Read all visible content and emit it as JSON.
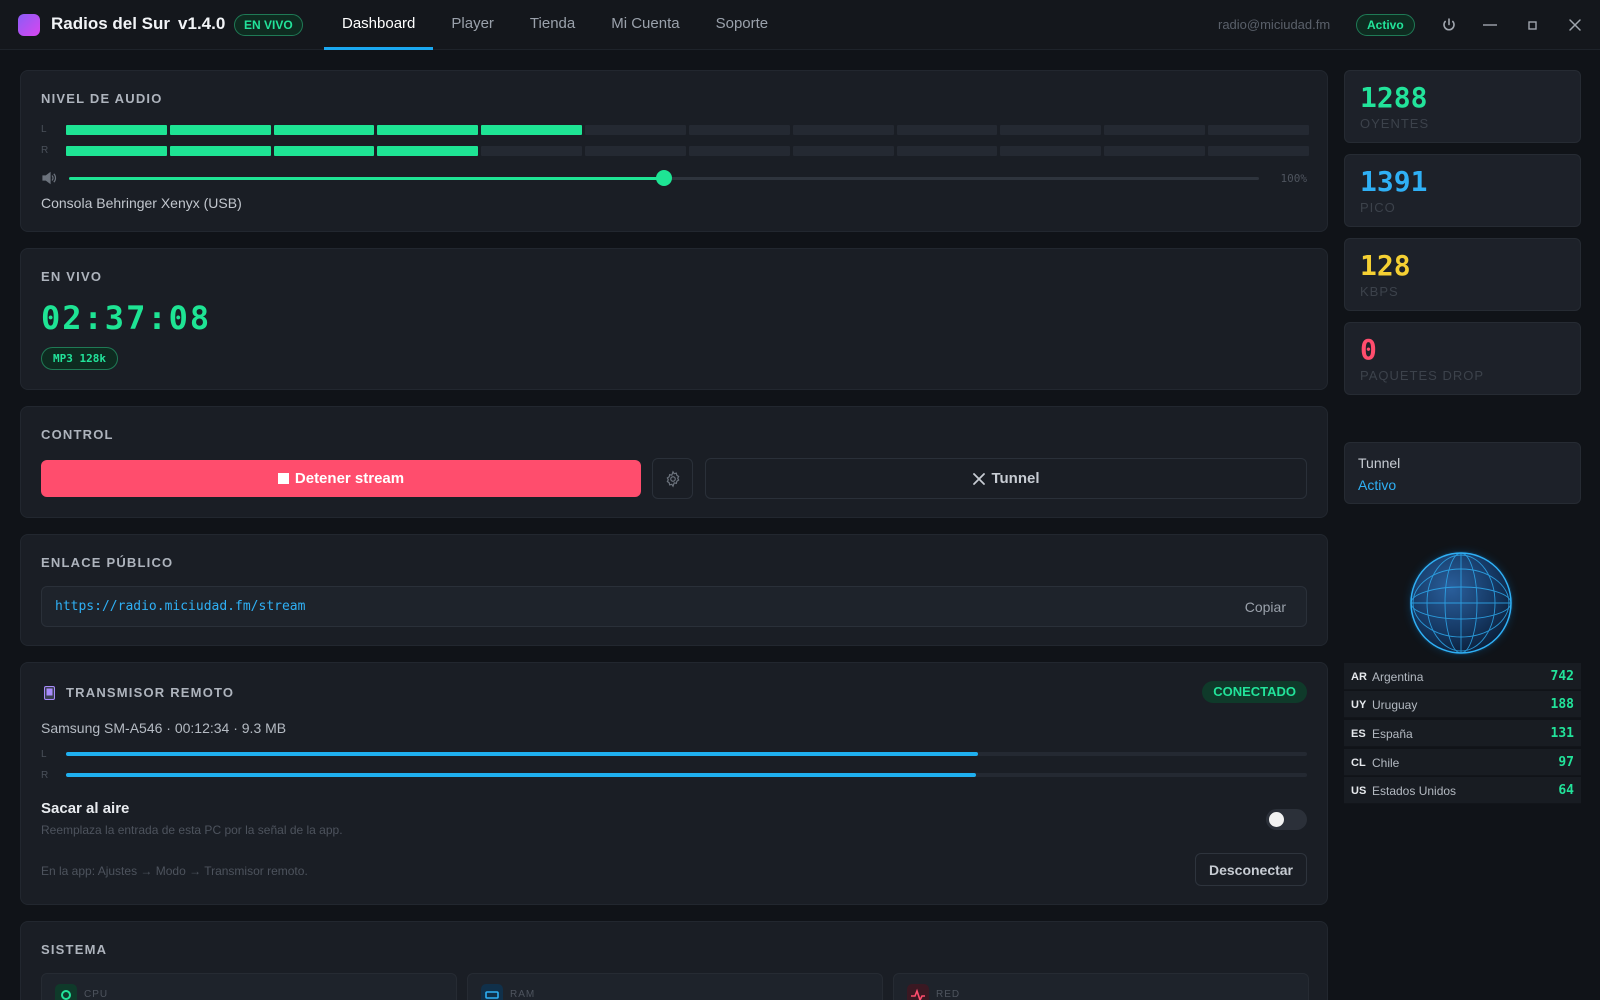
{
  "app": {
    "name": "Radios del Sur",
    "version": "v1.4.0",
    "live_badge": "EN VIVO"
  },
  "nav": {
    "tabs": [
      {
        "label": "Dashboard",
        "active": true
      },
      {
        "label": "Player",
        "active": false
      },
      {
        "label": "Tienda",
        "active": false
      },
      {
        "label": "Mi Cuenta",
        "active": false
      },
      {
        "label": "Soporte",
        "active": false
      }
    ]
  },
  "account": {
    "email": "radio@miciudad.fm",
    "status": "Activo"
  },
  "audio": {
    "title": "NIVEL DE AUDIO",
    "channel_left": "L",
    "channel_right": "R",
    "segments_total": 12,
    "left_segments_on": 5,
    "right_segments_on": 4,
    "volume_fraction": 0.5,
    "volume_percent_label": "100%",
    "device": "Consola Behringer Xenyx (USB)"
  },
  "live": {
    "title": "EN VIVO",
    "timer": "02:37:08",
    "codec": "MP3 128k"
  },
  "control": {
    "title": "CONTROL",
    "stop_label": "Detener stream",
    "tunnel_label": "Tunnel"
  },
  "public_link": {
    "title": "ENLACE PÚBLICO",
    "url": "https://radio.miciudad.fm/stream",
    "copy_label": "Copiar"
  },
  "remote": {
    "title": "TRANSMISOR REMOTO",
    "status": "CONECTADO",
    "info": "Samsung SM-A546 · 00:12:34 · 9.3 MB",
    "channel_left": "L",
    "channel_right": "R",
    "level_left": 0.735,
    "level_right": 0.733,
    "on_air_title": "Sacar al aire",
    "on_air_desc": "Reemplaza la entrada de esta PC por la señal de la app.",
    "on_air_enabled": false,
    "hint": "En la app: Ajustes → Modo → Transmisor remoto.",
    "disconnect_label": "Desconectar"
  },
  "system": {
    "title": "SISTEMA",
    "tiles": [
      {
        "label": "CPU",
        "icon": "cpu-icon",
        "color": "#22e39a"
      },
      {
        "label": "RAM",
        "icon": "ram-icon",
        "color": "#2fb0f5"
      },
      {
        "label": "RED",
        "icon": "network-icon",
        "color": "#ff4d6d"
      }
    ]
  },
  "stats": [
    {
      "value": "1288",
      "label": "OYENTES",
      "color": "#22e39a"
    },
    {
      "value": "1391",
      "label": "PICO",
      "color": "#2fb0f5"
    },
    {
      "value": "128",
      "label": "KBPS",
      "color": "#f5d033"
    },
    {
      "value": "0",
      "label": "PAQUETES DROP",
      "color": "#ff4d6d"
    }
  ],
  "tunnel": {
    "title": "Tunnel",
    "status": "Activo"
  },
  "countries": [
    {
      "code": "AR",
      "name": "Argentina",
      "count": "742"
    },
    {
      "code": "UY",
      "name": "Uruguay",
      "count": "188"
    },
    {
      "code": "ES",
      "name": "España",
      "count": "131"
    },
    {
      "code": "CL",
      "name": "Chile",
      "count": "97"
    },
    {
      "code": "US",
      "name": "Estados Unidos",
      "count": "64"
    }
  ],
  "colors": {
    "accent_green": "#1ee494",
    "accent_blue": "#1fb0f0",
    "danger": "#ff4d6d",
    "background": "#101318",
    "card": "#1a1e25"
  }
}
